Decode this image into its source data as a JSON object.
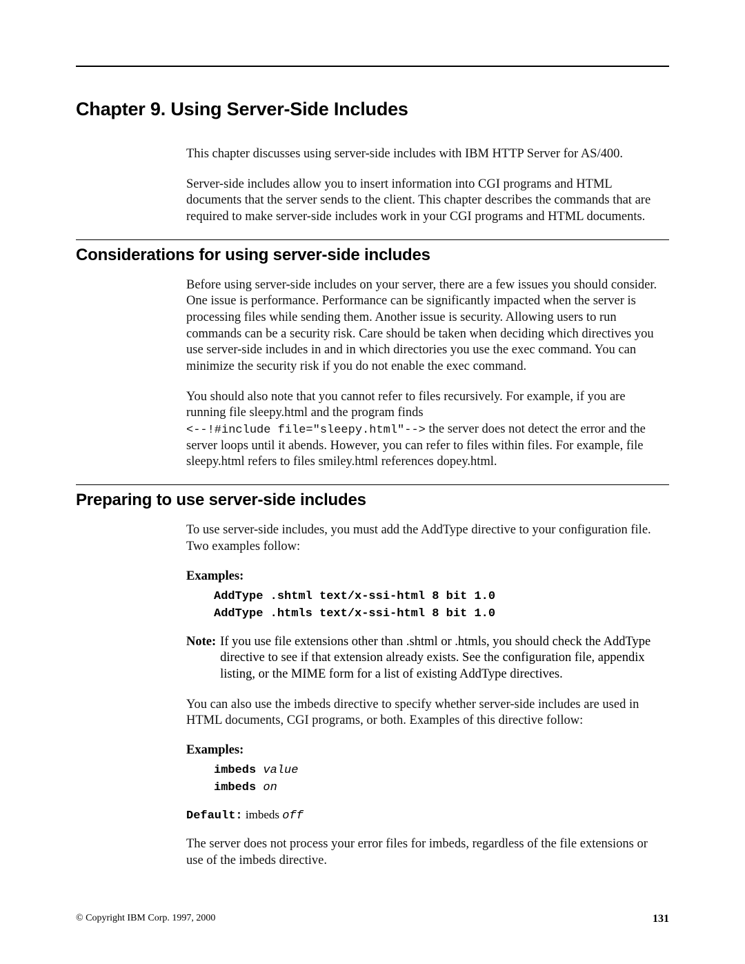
{
  "chapter_title": "Chapter 9. Using Server-Side Includes",
  "intro": {
    "p1": "This chapter discusses using server-side includes with IBM HTTP Server for AS/400.",
    "p2": "Server-side includes allow you to insert information into CGI programs and HTML documents that the server sends to the client. This chapter describes the commands that are required to make server-side includes work in your CGI programs and HTML documents."
  },
  "section1": {
    "heading": "Considerations for using server-side includes",
    "p1": "Before using server-side includes on your server, there are a few issues you should consider. One issue is performance. Performance can be significantly impacted when the server is processing files while sending them. Another issue is security. Allowing users to run commands can be a security risk. Care should be taken when deciding which directives you use server-side includes in and in which directories you use the exec command. You can minimize the security risk if you do not enable the exec command.",
    "p2_pre": "You should also note that you cannot refer to files recursively. For example, if you are running file sleepy.html and the program finds",
    "p2_code": "<--!#include file=\"sleepy.html\"-->",
    "p2_post": " the server does not detect the error and the server loops until it abends. However, you can refer to files within files. For example, file sleepy.html refers to files smiley.html references dopey.html."
  },
  "section2": {
    "heading": "Preparing to use server-side includes",
    "p1": "To use server-side includes, you must add the AddType directive to your configuration file. Two examples follow:",
    "examples_label": "Examples:",
    "code1_line1": "AddType .shtml text/x-ssi-html 8 bit 1.0",
    "code1_line2": "AddType .htmls text/x-ssi-html 8 bit 1.0",
    "note_label": "Note:",
    "note_text": "If you use file extensions other than .shtml or .htmls, you should check the AddType directive to see if that extension already exists. See the configuration file, appendix listing, or the MIME form for a list of existing AddType directives.",
    "p2": "You can also use the imbeds directive to specify whether server-side includes are used in HTML documents, CGI programs, or both. Examples of this directive follow:",
    "code2_line1_bold": "imbeds",
    "code2_line1_ital": "value",
    "code2_line2_bold": "imbeds",
    "code2_line2_ital": "on",
    "default_label": "Default:",
    "default_roman": " imbeds ",
    "default_ital": "off",
    "p3": "The server does not process your error files for imbeds, regardless of the file extensions or use of the imbeds directive."
  },
  "footer": {
    "copyright": "© Copyright IBM Corp. 1997, 2000",
    "page": "131"
  }
}
